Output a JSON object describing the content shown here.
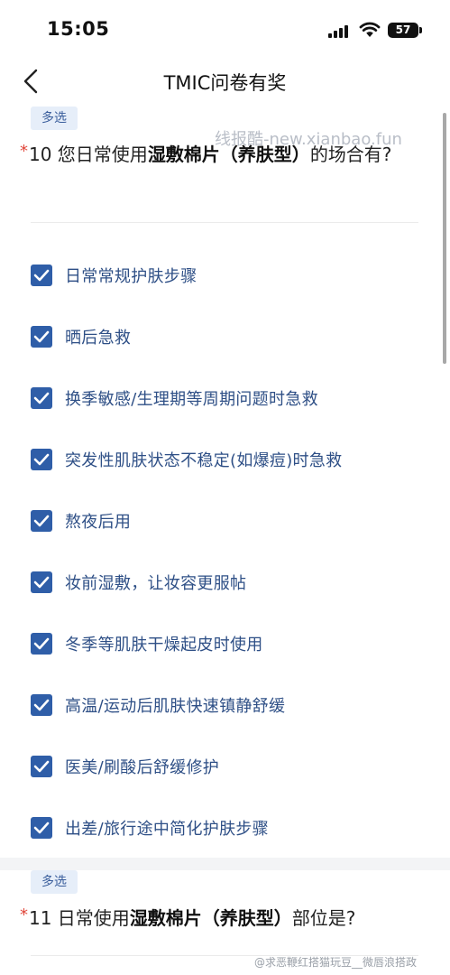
{
  "status": {
    "time": "15:05",
    "battery": "57"
  },
  "nav": {
    "title": "TMIC问卷有奖"
  },
  "watermark": "线报酷-new.xianbao.fun",
  "q10": {
    "tag": "多选",
    "req": "*",
    "number": "10 您日常使用",
    "bold": "湿敷棉片（养肤型）",
    "rest": "的场合有?",
    "options": [
      {
        "label": "日常常规护肤步骤",
        "checked": true
      },
      {
        "label": "晒后急救",
        "checked": true
      },
      {
        "label": "换季敏感/生理期等周期问题时急救",
        "checked": true
      },
      {
        "label": "突发性肌肤状态不稳定(如爆痘)时急救",
        "checked": true
      },
      {
        "label": "熬夜后用",
        "checked": true
      },
      {
        "label": "妆前湿敷，让妆容更服帖",
        "checked": true
      },
      {
        "label": "冬季等肌肤干燥起皮时使用",
        "checked": true
      },
      {
        "label": "高温/运动后肌肤快速镇静舒缓",
        "checked": true
      },
      {
        "label": "医美/刷酸后舒缓修护",
        "checked": true
      },
      {
        "label": "出差/旅行途中简化护肤步骤",
        "checked": true
      }
    ]
  },
  "q11": {
    "tag": "多选",
    "req": "*",
    "number": "11 日常使用",
    "bold": "湿敷棉片（养肤型）",
    "rest": "部位是?"
  },
  "footer_watermark": "@求恶鞭红搭猫玩豆__微唇浪搭政",
  "colors": {
    "accent": "#2f5ea8",
    "option_text": "#2e4f86",
    "required": "#e0463a",
    "tag_bg": "#e6eef9"
  }
}
